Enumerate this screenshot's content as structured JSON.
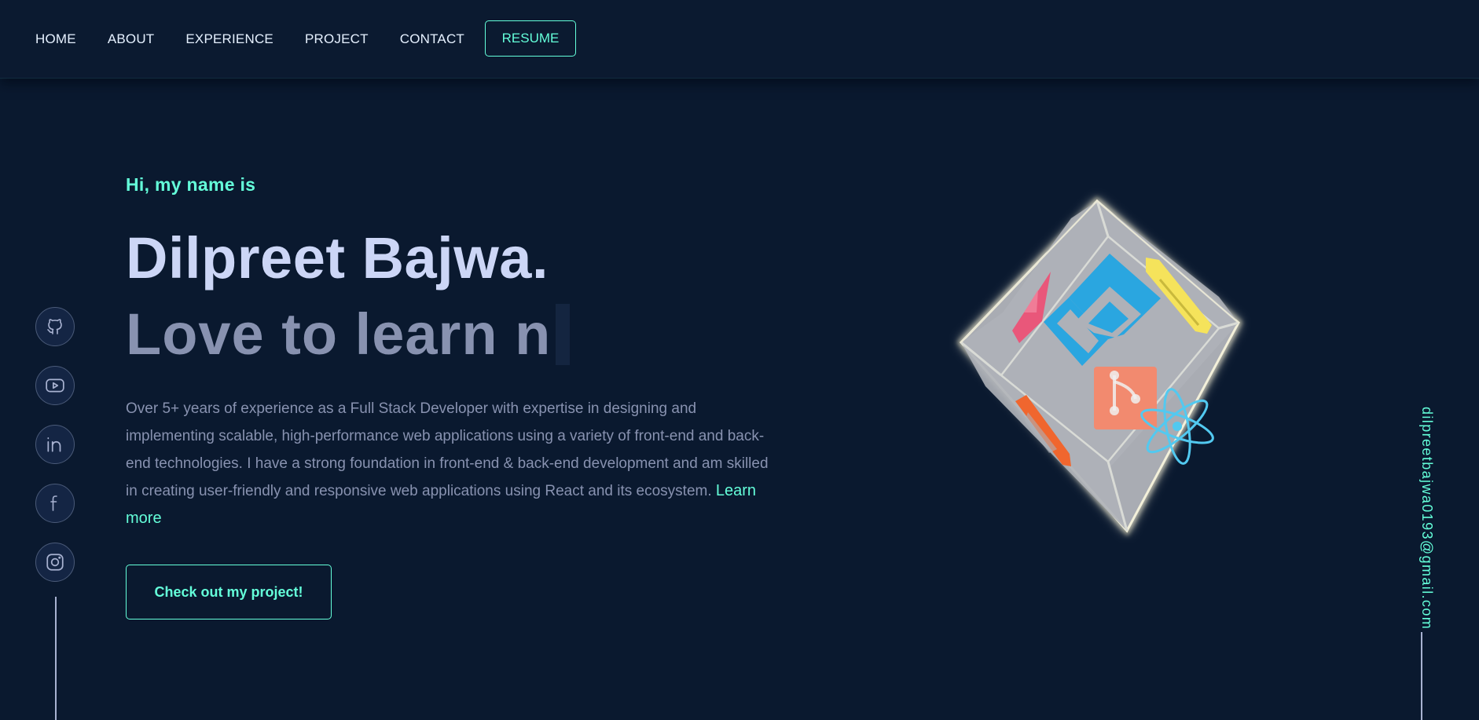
{
  "nav": {
    "items": [
      {
        "label": "HOME"
      },
      {
        "label": "ABOUT"
      },
      {
        "label": "EXPERIENCE"
      },
      {
        "label": "PROJECT"
      },
      {
        "label": "CONTACT"
      }
    ],
    "resume_label": "RESUME"
  },
  "hero": {
    "greeting": "Hi, my name is",
    "name": "Dilpreet Bajwa.",
    "tagline": "Love to learn n",
    "bio": "Over 5+ years of experience as a Full Stack Developer with expertise in designing and implementing scalable, high-performance web applications using a variety of front-end and back-end technologies. I have a strong foundation in front-end & back-end development and am skilled in creating user-friendly and responsive web applications using React and its ecosystem.",
    "learn_more": "Learn more",
    "cta_label": "Check out my project!"
  },
  "social": {
    "items": [
      {
        "icon": "github-icon"
      },
      {
        "icon": "youtube-icon"
      },
      {
        "icon": "linkedin-icon"
      },
      {
        "icon": "facebook-icon"
      },
      {
        "icon": "instagram-icon"
      }
    ]
  },
  "email": "dilpreetbajwa0193@gmail.com",
  "cube": {
    "icons": [
      "angular-icon",
      "css3-icon",
      "git-icon",
      "html5-icon",
      "react-icon",
      "javascript-icon"
    ]
  },
  "colors": {
    "background": "#0a192f",
    "accent": "#64ffda",
    "heading": "#ccd6f6",
    "muted": "#8892b0"
  }
}
